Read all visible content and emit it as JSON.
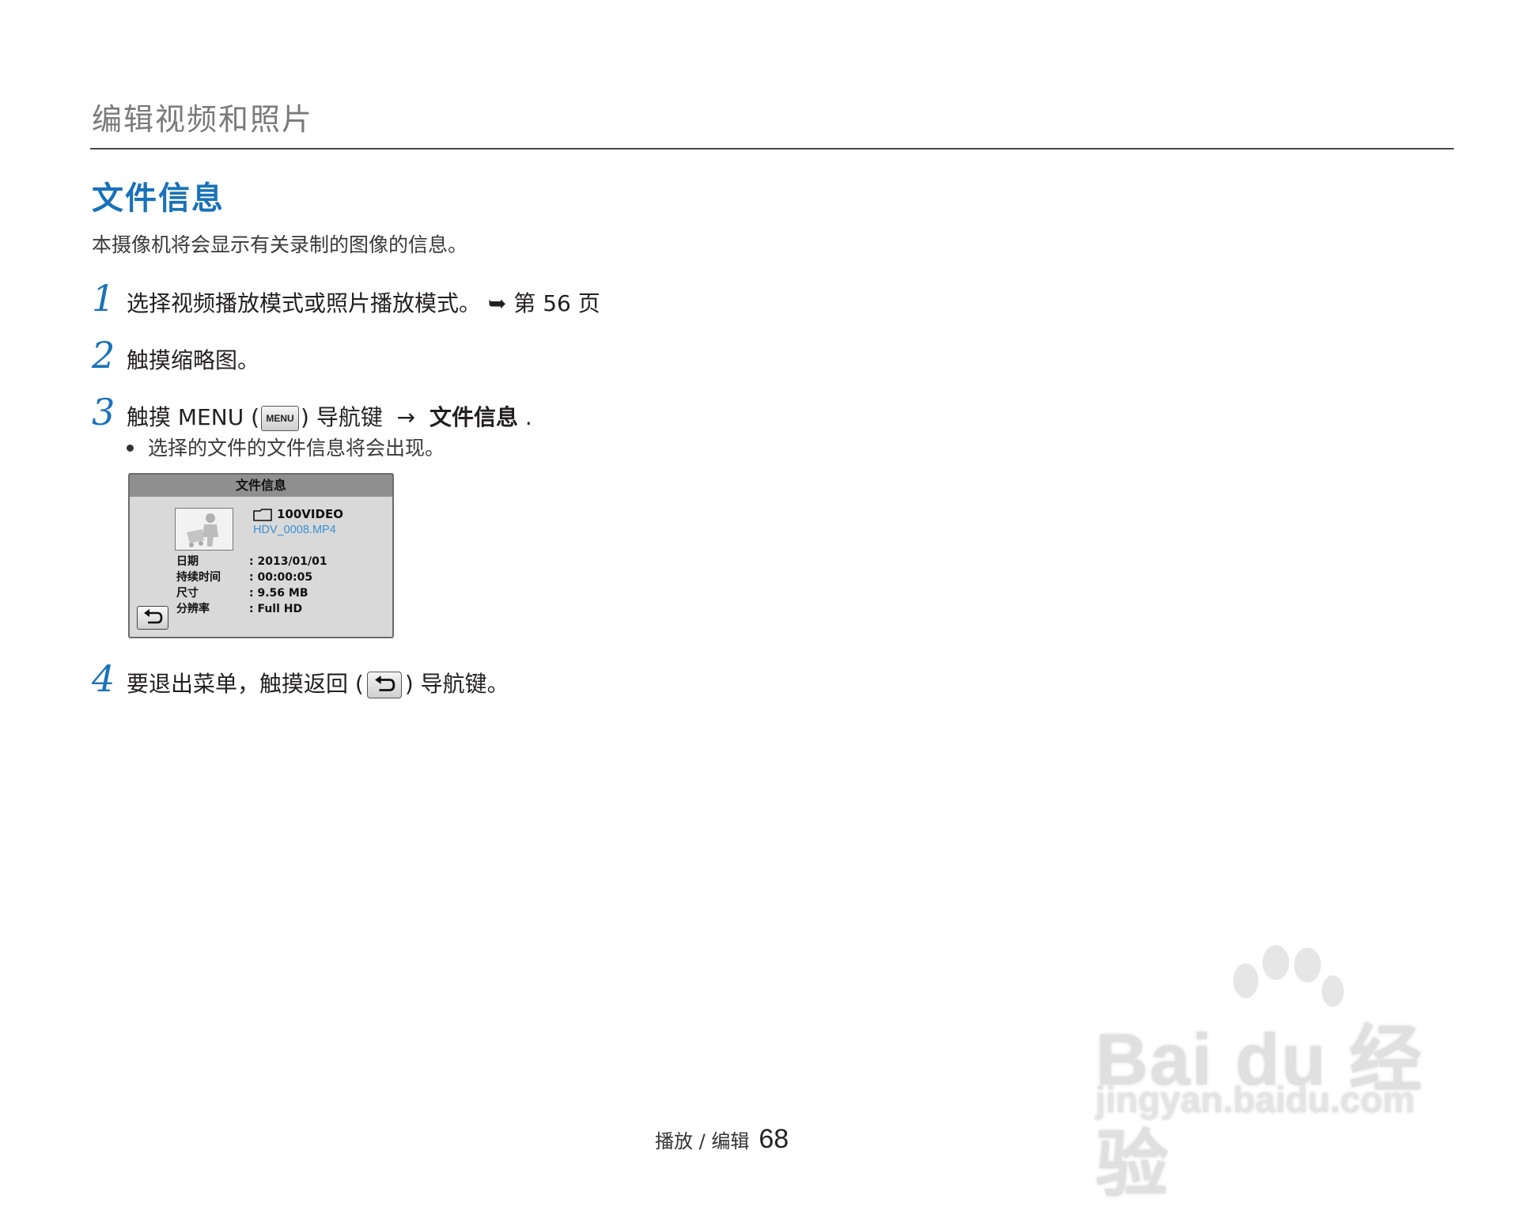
{
  "header": {
    "title": "编辑视频和照片"
  },
  "section": {
    "title": "文件信息",
    "intro": "本摄像机将会显示有关录制的图像的信息。"
  },
  "steps": [
    {
      "num": "1",
      "text_a": "选择视频播放模式或照片播放模式。",
      "arrow": "➥",
      "text_b": "第 56 页"
    },
    {
      "num": "2",
      "text": "触摸缩略图。"
    },
    {
      "num": "3",
      "text_a": "触摸 MENU (",
      "key": "MENU",
      "text_b": ") 导航键",
      "arrow": "→",
      "text_bold": "文件信息",
      "text_end": "."
    },
    {
      "num": "4",
      "text_a": "要退出菜单，触摸返回 (",
      "text_b": ") 导航键。"
    }
  ],
  "bullet": "选择的文件的文件信息将会出现。",
  "screen": {
    "title": "文件信息",
    "folder": "100VIDEO",
    "file": "HDV_0008.MP4",
    "rows": [
      {
        "label": "日期",
        "value": ": 2013/01/01"
      },
      {
        "label": "持续时间",
        "value": ": 00:00:05"
      },
      {
        "label": "尺寸",
        "value": ": 9.56 MB"
      },
      {
        "label": "分辨率",
        "value": ": Full HD"
      }
    ]
  },
  "footer": {
    "section": "播放 / 编辑",
    "page": "68"
  },
  "watermark": {
    "main": "Bai du 经验",
    "sub": "jingyan.baidu.com"
  },
  "colors": {
    "accent": "#1a72b8",
    "file_link": "#3c8fd4",
    "header_gray": "#7a7a7a"
  }
}
